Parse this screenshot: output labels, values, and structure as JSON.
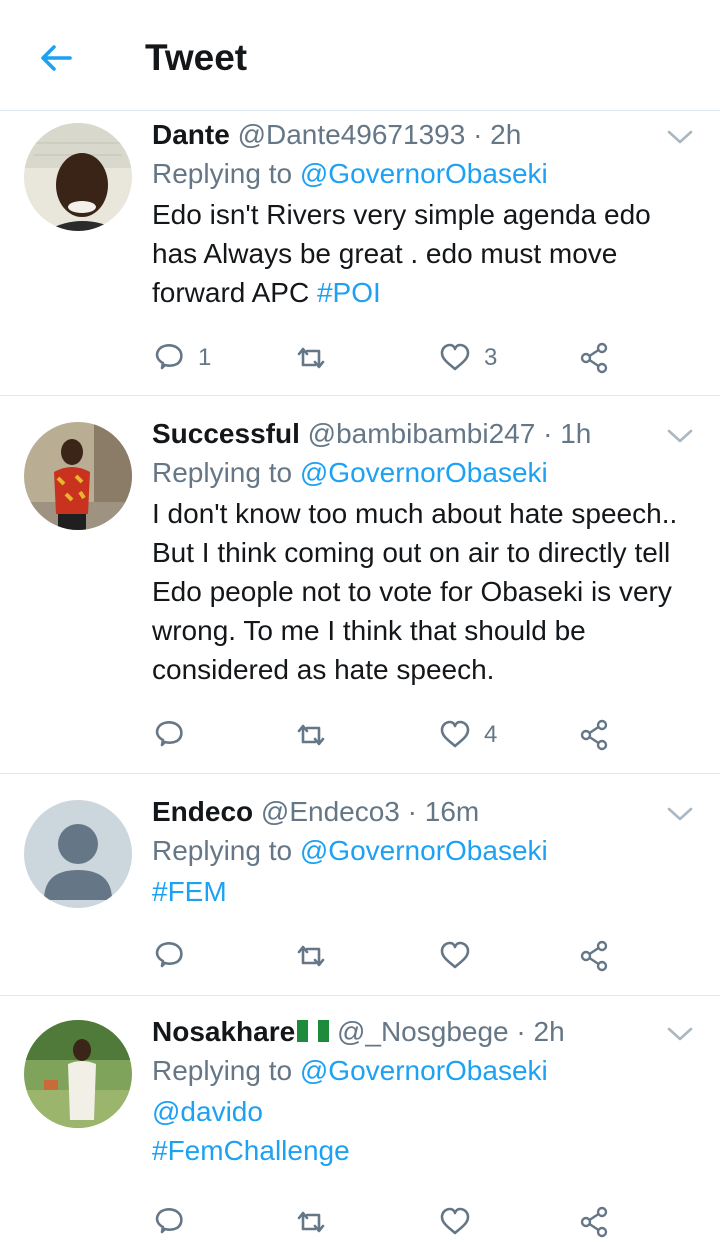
{
  "header": {
    "title": "Tweet"
  },
  "colors": {
    "accent": "#1da1f2",
    "muted": "#657786",
    "text": "#14171a",
    "divider": "#e1e8ed"
  },
  "tweets": [
    {
      "name": "Dante",
      "handle": "@Dante49671393",
      "time": "· 2h",
      "replying_prefix": "Replying to",
      "replying_to": "@GovernorObaseki",
      "text": "Edo isn't Rivers very simple agenda edo has Always be great . edo must move forward APC ",
      "hashtag": "#POI",
      "replies": "1",
      "retweets": "",
      "likes": "3"
    },
    {
      "name": "Successful",
      "handle": "@bambibambi247",
      "time": "· 1h",
      "replying_prefix": "Replying to",
      "replying_to": "@GovernorObaseki",
      "text": "I don't know too much about hate speech.. But I think coming out on air to directly tell Edo people not to vote for Obaseki is very wrong. To me I think that should be considered as hate speech.",
      "replies": "",
      "retweets": "",
      "likes": "4"
    },
    {
      "name": "Endeco",
      "handle": "@Endeco3",
      "time": "· 16m",
      "replying_prefix": "Replying to",
      "replying_to": "@GovernorObaseki",
      "hashtag": "#FEM",
      "replies": "",
      "retweets": "",
      "likes": ""
    },
    {
      "name": "Nosakhare",
      "flag_icon": "nigeria-flag-icon",
      "handle": "@_Nosgbege",
      "time": "· 2h",
      "replying_prefix": "Replying to",
      "replying_to": "@GovernorObaseki",
      "mention": "@davido",
      "hashtag": "#FemChallenge"
    }
  ]
}
